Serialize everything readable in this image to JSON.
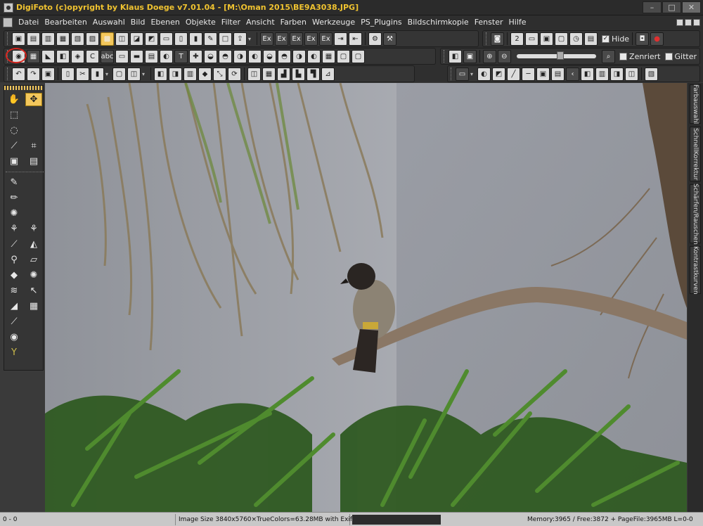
{
  "window": {
    "title": "DigiFoto (c)opyright by Klaus Doege v7.01.04 - [M:\\Oman 2015\\BE9A3038.JPG]",
    "controls": [
      "minimize",
      "maximize",
      "close"
    ]
  },
  "menu": {
    "items": [
      "Datei",
      "Bearbeiten",
      "Auswahl",
      "Bild",
      "Ebenen",
      "Objekte",
      "Filter",
      "Ansicht",
      "Farben",
      "Werkzeuge",
      "PS_Plugins",
      "Bildschirmkopie",
      "Fenster",
      "Hilfe"
    ]
  },
  "toolbar": {
    "hide_label": "Hide",
    "hide_checked": true,
    "center_label": "Zenriert",
    "center_checked": false,
    "grid_label": "Gitter",
    "grid_checked": false,
    "zoom_slider_value": 0.55
  },
  "dock_tabs": [
    "Farbauswahl",
    "SchnellKorrektur",
    "Schärfen/Rauschen",
    "Kontrastkurven"
  ],
  "status": {
    "position": "0 - 0",
    "image_info": "Image Size 3840x5760×TrueColors=63.28MB  with ExifData",
    "memory": "Memory:3965 / Free:3872 + PageFile:3965MB L=0-0"
  },
  "colors": {
    "title_text": "#f0c330",
    "active_tool": "#f3c75c",
    "highlight_circle": "#d8261f"
  }
}
